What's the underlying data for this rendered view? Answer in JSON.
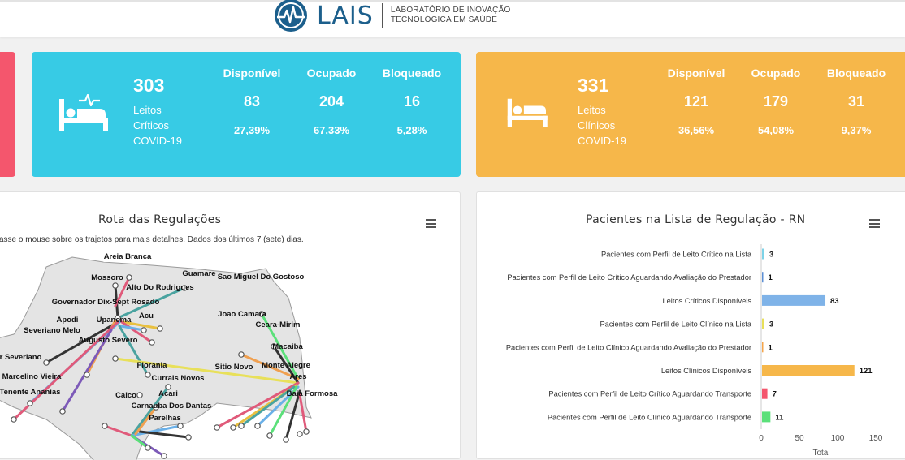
{
  "header": {
    "logo_word": "LAIS",
    "logo_line1": "LABORATÓRIO DE INOVAÇÃO",
    "logo_line2": "TECNOLÓGICA EM SAÚDE"
  },
  "cards": [
    {
      "total": "303",
      "label": [
        "Leitos",
        "Críticos",
        "COVID-19"
      ],
      "headers": [
        "Disponível",
        "Ocupado",
        "Bloqueado"
      ],
      "values": [
        "83",
        "204",
        "16"
      ],
      "percents": [
        "27,39%",
        "67,33%",
        "5,28%"
      ],
      "color": "#37cbe5",
      "icon": "hospital-bed-monitor-icon"
    },
    {
      "total": "331",
      "label": [
        "Leitos",
        "Clínicos",
        "COVID-19"
      ],
      "headers": [
        "Disponível",
        "Ocupado",
        "Bloqueado"
      ],
      "values": [
        "121",
        "179",
        "31"
      ],
      "percents": [
        "36,56%",
        "54,08%",
        "9,37%"
      ],
      "color": "#f6b74a",
      "icon": "bed-icon"
    }
  ],
  "route_panel": {
    "title": "Rota das Regulações",
    "hint": "asse o mouse sobre os trajetos para mais detalhes. Dados dos últimos 7 (sete) dias.",
    "cities": [
      "Areia Branca",
      "Guamare",
      "Sao Miguel Do Gostoso",
      "Mossoro",
      "Alto Do Rodrigues",
      "Governador Dix-Sept Rosado",
      "Apodi",
      "Acu",
      "Upanema",
      "Joao Camara",
      "Ceara-Mirim",
      "Severiano Melo",
      "Augusto Severo",
      "Macaiba",
      "tor Severiano",
      "Florania",
      "Sitio Novo",
      "Monte Alegre",
      "Marcelino Vieira",
      "Currais Novos",
      "Ares",
      "Tenente Ananias",
      "Acari",
      "Caico",
      "Baia Formosa",
      "Carnauba Dos Dantas",
      "Parelhas"
    ]
  },
  "chart_panel": {
    "title": "Pacientes na Lista de Regulação - RN",
    "chart_data": {
      "type": "bar",
      "orientation": "horizontal",
      "categories": [
        "Pacientes com Perfil de Leito Crítico na Lista",
        "Pacientes com Perfil de Leito Crítico Aguardando Avaliação do Prestador",
        "Leitos Críticos Disponíveis",
        "Pacientes com Perfil de Leito Clínico na Lista",
        "Pacientes com Perfil de Leito Clínico Aguardando Avaliação do Prestador",
        "Leitos Clínicos Disponíveis",
        "Pacientes com Perfil de Leito Crítico Aguardando Transporte",
        "Pacientes com Perfil de Leito Clínico Aguardando Transporte"
      ],
      "values": [
        3,
        1,
        83,
        3,
        1,
        121,
        7,
        11
      ],
      "colors": [
        "#7dd3e8",
        "#5b8fd6",
        "#7fb3e8",
        "#e8e05a",
        "#f6a54a",
        "#f6b74a",
        "#f4566d",
        "#5be07a"
      ],
      "xticks": [
        "0",
        "50",
        "100",
        "150"
      ],
      "xlim": [
        0,
        150
      ],
      "xlabel": "Total"
    }
  }
}
